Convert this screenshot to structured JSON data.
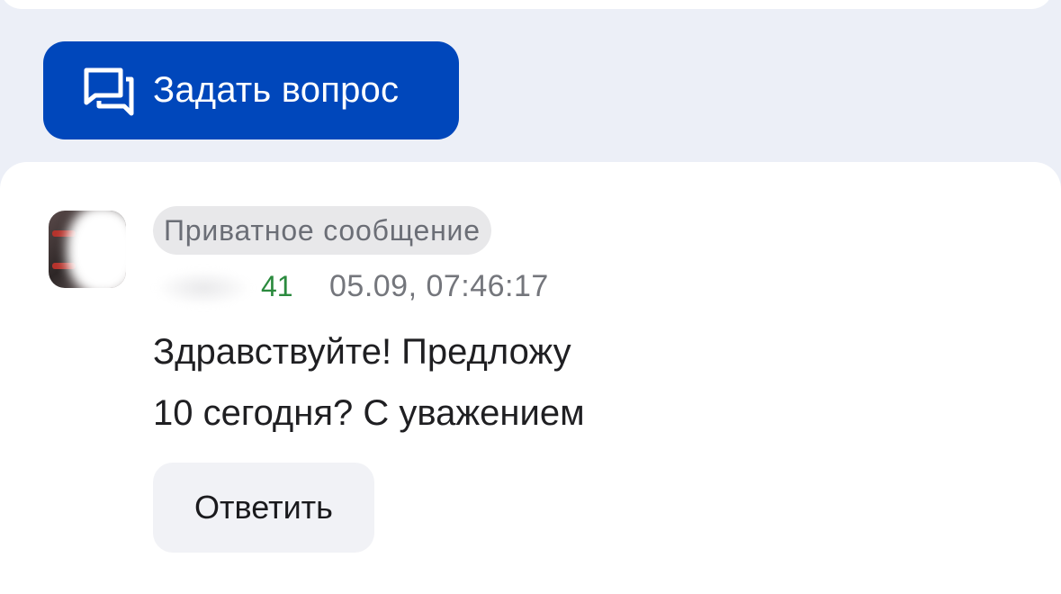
{
  "ask_button": {
    "label": "Задать вопрос",
    "icon": "chat-bubbles-icon",
    "color": "#0047bb"
  },
  "message": {
    "badge": "Приватное сообщение",
    "author_rating": "41",
    "timestamp": "05.09, 07:46:17",
    "text_lines": [
      "Здравствуйте! Предложу",
      "10 сегодня? С уважением"
    ],
    "reply_label": "Ответить"
  },
  "colors": {
    "background": "#eceff7",
    "card": "#ffffff",
    "rating": "#2b8a3e",
    "muted": "#74767c"
  }
}
